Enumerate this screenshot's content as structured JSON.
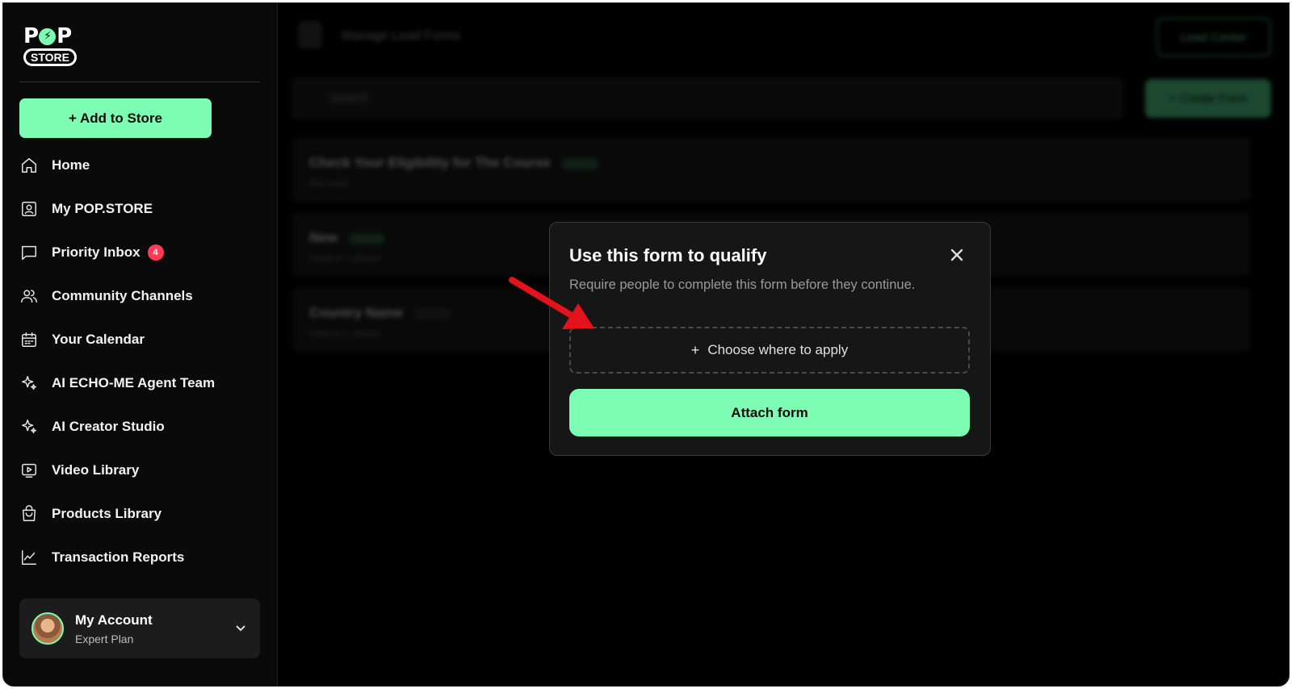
{
  "brand": {
    "logo_top": "P P",
    "logo_top_left": "P",
    "logo_top_right": "P",
    "logo_bottom": "STORE"
  },
  "sidebar": {
    "add_button": "+ Add to Store",
    "items": [
      {
        "label": "Home",
        "icon": "home-icon"
      },
      {
        "label": "My POP.STORE",
        "icon": "user-card-icon"
      },
      {
        "label": "Priority Inbox",
        "icon": "chat-icon",
        "badge": "4"
      },
      {
        "label": "Community Channels",
        "icon": "users-icon"
      },
      {
        "label": "Your Calendar",
        "icon": "calendar-icon"
      },
      {
        "label": "AI ECHO-ME Agent Team",
        "icon": "sparkle-icon"
      },
      {
        "label": "AI Creator Studio",
        "icon": "sparkle-icon"
      },
      {
        "label": "Video Library",
        "icon": "video-icon"
      },
      {
        "label": "Products Library",
        "icon": "bag-icon"
      },
      {
        "label": "Transaction Reports",
        "icon": "chart-icon"
      }
    ],
    "account": {
      "name": "My Account",
      "plan": "Expert Plan"
    }
  },
  "background": {
    "title": "Manage Lead Forms",
    "lead_center": "Lead Center",
    "search_placeholder": "Search",
    "create_form": "+ Create Form",
    "rows": [
      {
        "title": "Check Your Eligibility for The Course",
        "sub": "Not used"
      },
      {
        "title": "New",
        "sub": "Used in 1 places"
      },
      {
        "title": "Country Name",
        "sub": "Used in 1 places"
      }
    ]
  },
  "modal": {
    "title": "Use this form to qualify",
    "subtitle": "Require people to complete this form before they continue.",
    "choose_plus": "+",
    "choose_label": "Choose where to apply",
    "attach_button": "Attach form"
  },
  "colors": {
    "accent": "#7dfdb3",
    "badge": "#ff3b57",
    "annotation": "#e3121b"
  }
}
